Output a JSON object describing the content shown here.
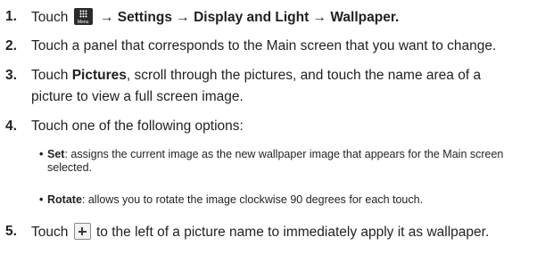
{
  "steps": [
    {
      "num": "1.",
      "pre": "Touch",
      "icon_label": "Menu",
      "icon_name": "menu-grid-icon",
      "post": "→ Settings → Display and Light → Wallpaper."
    },
    {
      "num": "2.",
      "text": "Touch a panel that corresponds to the Main screen that you want to change."
    },
    {
      "num": "3.",
      "pre": "Touch",
      "bold": "Pictures",
      "post": ", scroll through the pictures, and touch the name area of a",
      "line2": "picture to view a full screen image."
    },
    {
      "num": "4.",
      "text": "Touch one of the following options:"
    },
    {
      "num": "5.",
      "pre": "Touch",
      "icon_name": "plus-icon",
      "post": "to the left of a picture name to immediately apply it as wallpaper."
    }
  ],
  "bullets": [
    {
      "dot": "•",
      "term": "Set",
      "desc": ": assigns the current image as the new wallpaper image that appears for the Main screen selected."
    },
    {
      "dot": "•",
      "term": "Rotate",
      "desc": ": allows you to rotate the image clockwise 90 degrees for each touch."
    }
  ]
}
